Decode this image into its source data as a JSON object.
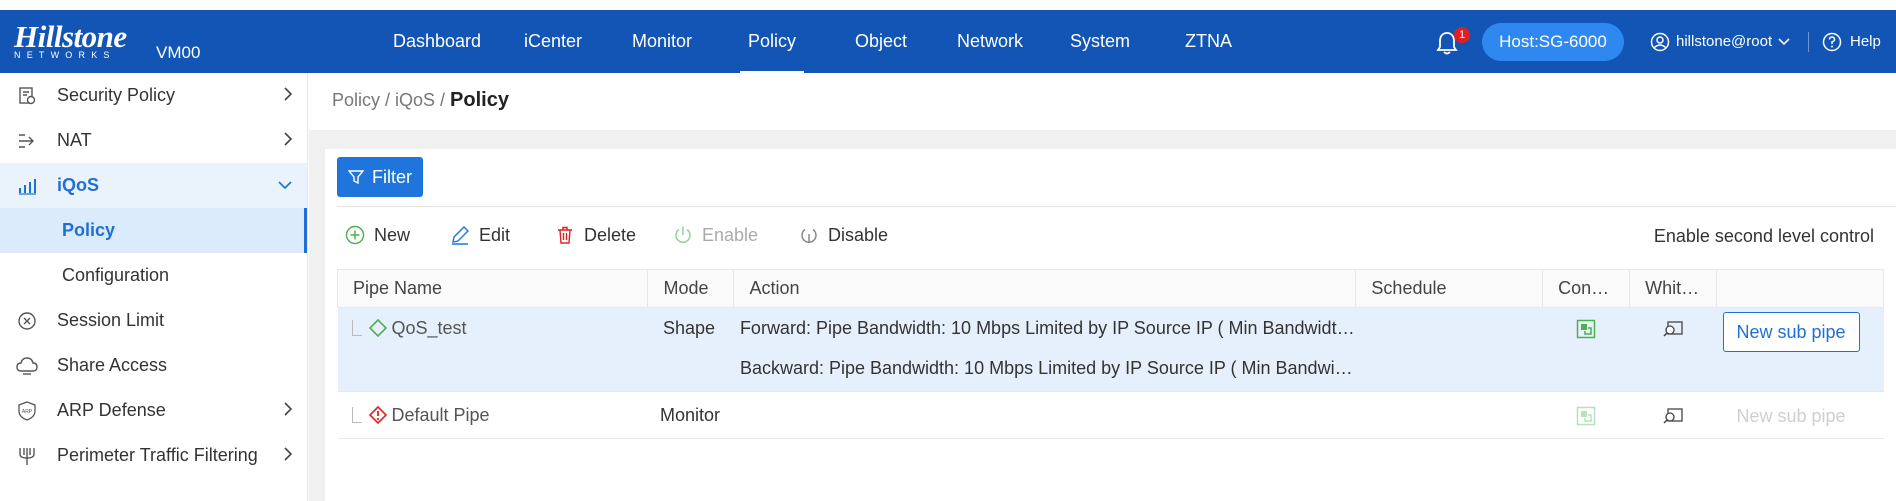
{
  "brand": {
    "logo_text": "Hillstone",
    "logo_sub": "NETWORKS",
    "device": "VM00"
  },
  "nav": [
    "Dashboard",
    "iCenter",
    "Monitor",
    "Policy",
    "Object",
    "Network",
    "System",
    "ZTNA"
  ],
  "nav_active": "Policy",
  "header": {
    "notification_count": "1",
    "host": "Host:SG-6000",
    "user": "hillstone@root",
    "help": "Help"
  },
  "sidebar": {
    "items": [
      {
        "label": "Security Policy",
        "icon": "shield-policy-icon"
      },
      {
        "label": "NAT",
        "icon": "nat-arrow-icon"
      },
      {
        "label": "iQoS",
        "icon": "bar-chart-icon"
      },
      {
        "label": "Policy"
      },
      {
        "label": "Configuration"
      },
      {
        "label": "Session Limit",
        "icon": "circle-x-icon"
      },
      {
        "label": "Share Access",
        "icon": "cloud-share-icon"
      },
      {
        "label": "ARP Defense",
        "icon": "arp-shield-icon"
      },
      {
        "label": "Perimeter Traffic Filtering",
        "icon": "trident-icon"
      }
    ]
  },
  "breadcrumb": {
    "path": "Policy / iQoS / ",
    "current": "Policy"
  },
  "toolbar": {
    "filter": "Filter",
    "new": "New",
    "edit": "Edit",
    "delete": "Delete",
    "enable": "Enable",
    "disable": "Disable",
    "second_level": "Enable second level control"
  },
  "table": {
    "columns": [
      "Pipe Name",
      "Mode",
      "Action",
      "Schedule",
      "Con…",
      "Whit…",
      ""
    ],
    "rows": [
      {
        "name": "QoS_test",
        "mode": "Shape",
        "action_forward": "Forward: Pipe Bandwidth: 10 Mbps Limited by IP Source IP ( Min Bandwidt…",
        "action_backward": "Backward: Pipe Bandwidth: 10 Mbps Limited by IP Source IP ( Min Bandwi…",
        "schedule": "",
        "button": "New sub pipe"
      },
      {
        "name": "Default Pipe",
        "mode": "Monitor",
        "action_forward": "",
        "schedule": "",
        "button": "New sub pipe"
      }
    ]
  },
  "colors": {
    "topbar": "#1255b5",
    "host_pill": "#2f88f0",
    "accent": "#1f6fd6",
    "selected_row": "#e6f0fc",
    "enabled_green": "#4caf50"
  }
}
